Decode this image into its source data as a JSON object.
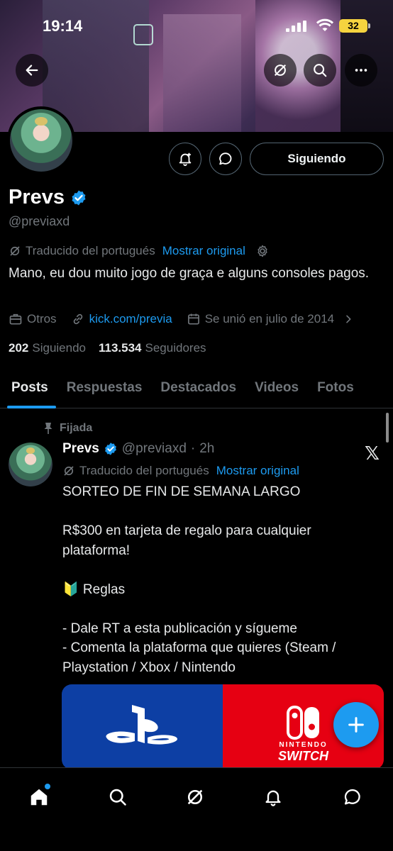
{
  "status_bar": {
    "time": "19:14",
    "battery": "32"
  },
  "profile": {
    "name": "Prevs",
    "handle": "@previaxd",
    "follow_button": "Siguiendo",
    "translated_from": "Traducido del portugués",
    "show_original": "Mostrar original",
    "bio": "Mano, eu dou muito jogo de graça e alguns consoles pagos.",
    "category": "Otros",
    "website": "kick.com/previa",
    "joined": "Se unió en julio de 2014",
    "following_count": "202",
    "following_label": "Siguiendo",
    "followers_count": "113.534",
    "followers_label": "Seguidores"
  },
  "tabs": [
    "Posts",
    "Respuestas",
    "Destacados",
    "Videos",
    "Fotos"
  ],
  "post": {
    "pinned_label": "Fijada",
    "author_name": "Prevs",
    "author_handle": "@previaxd",
    "time": "2h",
    "translated_from": "Traducido del portugués",
    "show_original": "Mostrar original",
    "lines": [
      "SORTEO DE FIN DE SEMANA LARGO",
      "",
      "R$300 en tarjeta de regalo para cualquier plataforma!",
      "",
      "🔰 Reglas",
      "",
      "- Dale RT a esta publicación y sígueme",
      "- Comenta la plataforma que quieres (Steam / Playstation / Xbox / Nintendo"
    ],
    "image": {
      "right_brand_top": "NINTENDO",
      "right_brand_bottom": "SWITCH"
    }
  },
  "colors": {
    "accent": "#1d9bf0",
    "background": "#000000",
    "muted": "#71767b",
    "playstation": "#0d3fa4",
    "nintendo": "#e60012"
  },
  "icons": [
    "back-arrow-icon",
    "grok-icon",
    "search-icon",
    "more-icon",
    "notification-bell-icon",
    "message-icon",
    "verified-badge-icon",
    "settings-gear-icon",
    "briefcase-icon",
    "link-icon",
    "calendar-icon",
    "pin-icon",
    "x-logo-icon",
    "compose-plus-icon",
    "home-icon",
    "bell-icon",
    "envelope-icon"
  ]
}
